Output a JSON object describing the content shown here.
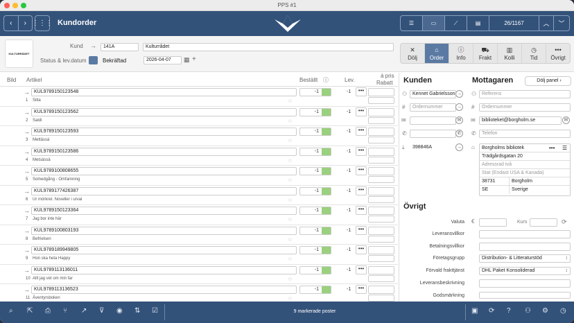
{
  "window": {
    "title": "PPS #1"
  },
  "nav": {
    "title": "Kundorder",
    "counter": "26/1167"
  },
  "header": {
    "logo_text": "KULTURRÅDET",
    "kund_label": "Kund",
    "kund_id": "141A",
    "kund_name": "Kulturrådet",
    "status_label": "Status & lev.datum",
    "status_value": "Bekräftad",
    "status_color": "#5b7aa3",
    "date": "2026-04-07"
  },
  "tabs": [
    {
      "label": "Dölj",
      "icon": "close-icon",
      "glyph": "✕"
    },
    {
      "label": "Order",
      "icon": "home-icon",
      "glyph": "⌂",
      "active": true
    },
    {
      "label": "Info",
      "icon": "info-icon",
      "glyph": "ⓘ"
    },
    {
      "label": "Frakt",
      "icon": "truck-icon",
      "glyph": "⛟"
    },
    {
      "label": "Kolli",
      "icon": "box-icon",
      "glyph": "▥"
    },
    {
      "label": "Tid",
      "icon": "clock-icon",
      "glyph": "◷"
    },
    {
      "label": "Övrigt",
      "icon": "more-icon",
      "glyph": "•••"
    }
  ],
  "columns": {
    "bild": "Bild",
    "artikel": "Artikel",
    "bestallt": "Beställt",
    "lev": "Lev.",
    "pris": "á pris",
    "rabatt": "Rabatt"
  },
  "rows": [
    {
      "article": "KUL9789150123548",
      "num": "1",
      "name": "Silta",
      "qty": "-1",
      "lev": "-1"
    },
    {
      "article": "KUL9789150123562",
      "num": "2",
      "name": "Saldi",
      "qty": "-1",
      "lev": "-1"
    },
    {
      "article": "KUL9789150123593",
      "num": "3",
      "name": "Mettässä",
      "qty": "-1",
      "lev": "-1"
    },
    {
      "article": "KUL9789150123586",
      "num": "4",
      "name": "Metsässä",
      "qty": "-1",
      "lev": "-1"
    },
    {
      "article": "KUL9789100808655",
      "num": "5",
      "name": "Solnedgång - Omfamning",
      "qty": "-1",
      "lev": "-1"
    },
    {
      "article": "KUL9789177426387",
      "num": "6",
      "name": "Ur mörkret. Noveller i urval",
      "qty": "-1",
      "lev": "-1"
    },
    {
      "article": "KUL9789150123364",
      "num": "7",
      "name": "Jag bor inte här",
      "qty": "-1",
      "lev": "-1"
    },
    {
      "article": "KUL9789100803193",
      "num": "8",
      "name": "Befrielsen",
      "qty": "-1",
      "lev": "-1"
    },
    {
      "article": "KUL9789189949805",
      "num": "9",
      "name": "Hon ska heta Happy",
      "qty": "-1",
      "lev": "-1"
    },
    {
      "article": "KUL9789113136011",
      "num": "10",
      "name": "Allt jag vet om min far",
      "qty": "-1",
      "lev": "-1"
    },
    {
      "article": "KUL9789113136523",
      "num": "11",
      "name": "Äventyrsboken",
      "qty": "-1",
      "lev": "-1"
    }
  ],
  "kunden": {
    "title": "Kunden",
    "contact": "Kennet Gabrielsson",
    "ordernummer_ph": "Ordernummer",
    "id": "398846A"
  },
  "mottagaren": {
    "title": "Mottagaren",
    "hide_label": "Dölj panel",
    "referens_ph": "Referens",
    "ordernummer_ph": "Ordernummer",
    "email": "biblioteket@borgholm.se",
    "telefon_ph": "Telefon",
    "name": "Borgholms bibliotek",
    "street": "Trädgårdsgatan 20",
    "adress2_ph": "Adressrad två",
    "stat_ph": "Stat (Endast USA & Kanada)",
    "zip": "38731",
    "city": "Borgholm",
    "country": "SE",
    "country_name": "Sverige"
  },
  "ovrigt": {
    "title": "Övrigt",
    "valuta": "Valuta",
    "currency_sign": "€",
    "kurs": "Kurs",
    "leveransvillkor": "Leveransvillkor",
    "betalningsvillkor": "Betalningsvillkor",
    "foretagsgrupp": "Företagsgrupp",
    "foretagsgrupp_val": "Distribution- & Litteraturstöd",
    "fraktjanst": "Förvald frakttjänst",
    "fraktjanst_val": "DHL Paket Konsoliderad",
    "leveransbeskrivning": "Leveransbeskrivning",
    "godsmarkning": "Godsmärkning"
  },
  "footer": {
    "status": "9 markerade poster"
  }
}
